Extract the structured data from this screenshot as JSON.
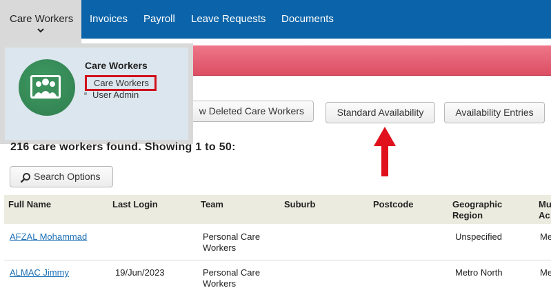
{
  "nav": {
    "items": [
      {
        "label": "Care Workers"
      },
      {
        "label": "Invoices"
      },
      {
        "label": "Payroll"
      },
      {
        "label": "Leave Requests"
      },
      {
        "label": "Documents"
      }
    ],
    "active_index": 0,
    "bar_color": "#0b64a9"
  },
  "dropdown": {
    "heading": "Care Workers",
    "links": [
      "Care Workers",
      "User Admin"
    ],
    "icon": "people-group-icon",
    "highlight_color": "#d0101c"
  },
  "actions": {
    "view_deleted_partial": "w Deleted Care Workers",
    "standard_availability": "Standard Availability",
    "availability_entries": "Availability Entries"
  },
  "annotation": {
    "arrow_color": "#e0101c"
  },
  "results": {
    "summary": "216 care workers found. Showing 1 to 50:"
  },
  "search": {
    "label": "Search Options",
    "icon": "magnifier-icon"
  },
  "table": {
    "columns": [
      "Full Name",
      "Last Login",
      "Team",
      "Suburb",
      "Postcode",
      "Geographic",
      "Region",
      "Mu",
      "Ac"
    ],
    "rows": [
      {
        "name": "AFZAL Mohammad",
        "last_login": "",
        "team_line1": "Personal Care",
        "team_line2": "Workers",
        "suburb": "",
        "postcode": "",
        "region": "Unspecified",
        "extra": "Me"
      },
      {
        "name": "ALMAC Jimmy",
        "last_login": "19/Jun/2023",
        "team_line1": "Personal Care",
        "team_line2": "Workers",
        "suburb": "",
        "postcode": "",
        "region": "Metro North",
        "extra": "Me"
      }
    ]
  }
}
